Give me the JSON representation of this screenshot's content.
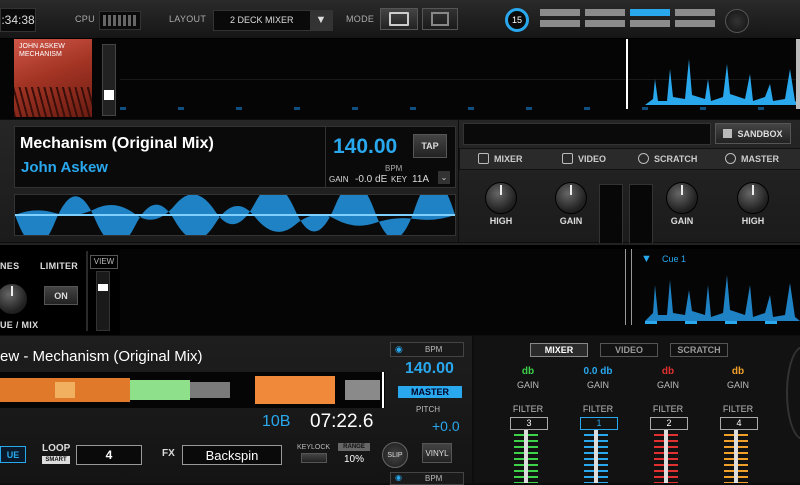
{
  "topbar": {
    "clock": ":34:38",
    "cpu_label": "CPU",
    "layout_label": "LAYOUT",
    "layout_value": "2 DECK MIXER",
    "mode_label": "MODE",
    "sync_number": "15"
  },
  "deck1": {
    "album_art_text": "JOHN ASKEW MECHANISM",
    "title": "Mechanism (Original Mix)",
    "artist": "John Askew",
    "bpm": "140.00",
    "bpm_label": "BPM",
    "tap_label": "TAP",
    "gain_label": "GAIN",
    "gain_value": "-0.0 dE",
    "key_label": "KEY",
    "key_value": "11A"
  },
  "right_panel": {
    "sandbox_label": "SANDBOX",
    "tabs": [
      "MIXER",
      "VIDEO",
      "SCRATCH",
      "MASTER"
    ],
    "knob_labels": [
      "HIGH",
      "GAIN",
      "GAIN",
      "HIGH"
    ]
  },
  "middle": {
    "phones_label": "NES",
    "limiter_label": "LIMITER",
    "limiter_value": "ON",
    "cue_mix_label": "UE / MIX",
    "view_label": "VIEW",
    "cue_marker": "Cue 1"
  },
  "deck2": {
    "title": "ew - Mechanism (Original Mix)",
    "bpm": "140.00",
    "bpm_tag": "BPM",
    "master_label": "MASTER",
    "pitch_label": "PITCH",
    "pitch_value": "+0.0",
    "key": "10B",
    "time": "07:22.6",
    "cue_btn": "UE",
    "loop_label": "LOOP",
    "smart_label": "SMART",
    "loop_value": "4",
    "fx_label": "FX",
    "fx_value": "Backspin",
    "keylock_label": "KEYLOCK",
    "range_label": "RANGE",
    "range_value": "10%",
    "slip_label": "SLIP",
    "vinyl_label": "VINYL"
  },
  "mixer": {
    "tabs": [
      "MIXER",
      "VIDEO",
      "SCRATCH"
    ],
    "channels": [
      {
        "db": "db",
        "color": "#3cd24a",
        "gain": "GAIN",
        "filter": "FILTER",
        "num": "3"
      },
      {
        "db": "0.0 db",
        "color": "#29a8ee",
        "gain": "GAIN",
        "filter": "FILTER",
        "num": "1"
      },
      {
        "db": "db",
        "color": "#e23030",
        "gain": "GAIN",
        "filter": "FILTER",
        "num": "2"
      },
      {
        "db": "db",
        "color": "#f0a02a",
        "gain": "GAIN",
        "filter": "FILTER",
        "num": "4"
      }
    ]
  }
}
